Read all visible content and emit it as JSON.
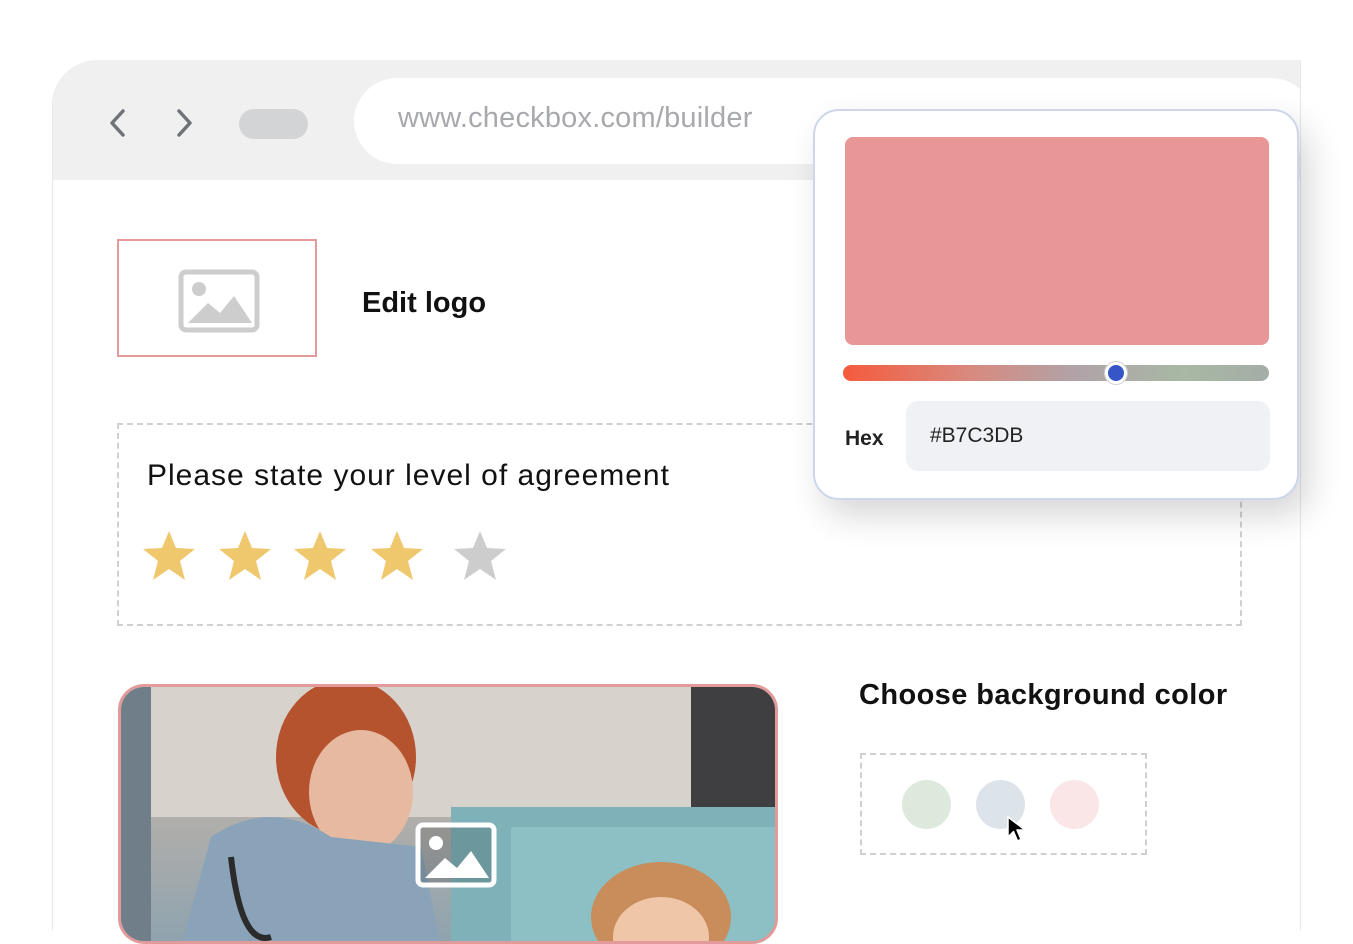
{
  "browser": {
    "url": "www.checkbox.com/builder",
    "icons": {
      "back": "chevron-left-icon",
      "forward": "chevron-right-icon"
    }
  },
  "logo": {
    "label": "Edit logo",
    "icon": "image-icon"
  },
  "question": {
    "text": "Please state your level of agreement",
    "rating": 4,
    "max_rating": 5,
    "star_color": "#EFC76D",
    "empty_star_color": "#CDCDCD"
  },
  "background": {
    "title": "Choose background color",
    "swatches": [
      "#DDE9DD",
      "#DDE4E9",
      "#FBE6E7"
    ]
  },
  "color_picker": {
    "preview_color": "#E99697",
    "hex_label": "Hex",
    "hex_value": "#B7C3DB",
    "slider_value": 0.64
  },
  "colors": {
    "accent_border": "#E39A9A"
  }
}
